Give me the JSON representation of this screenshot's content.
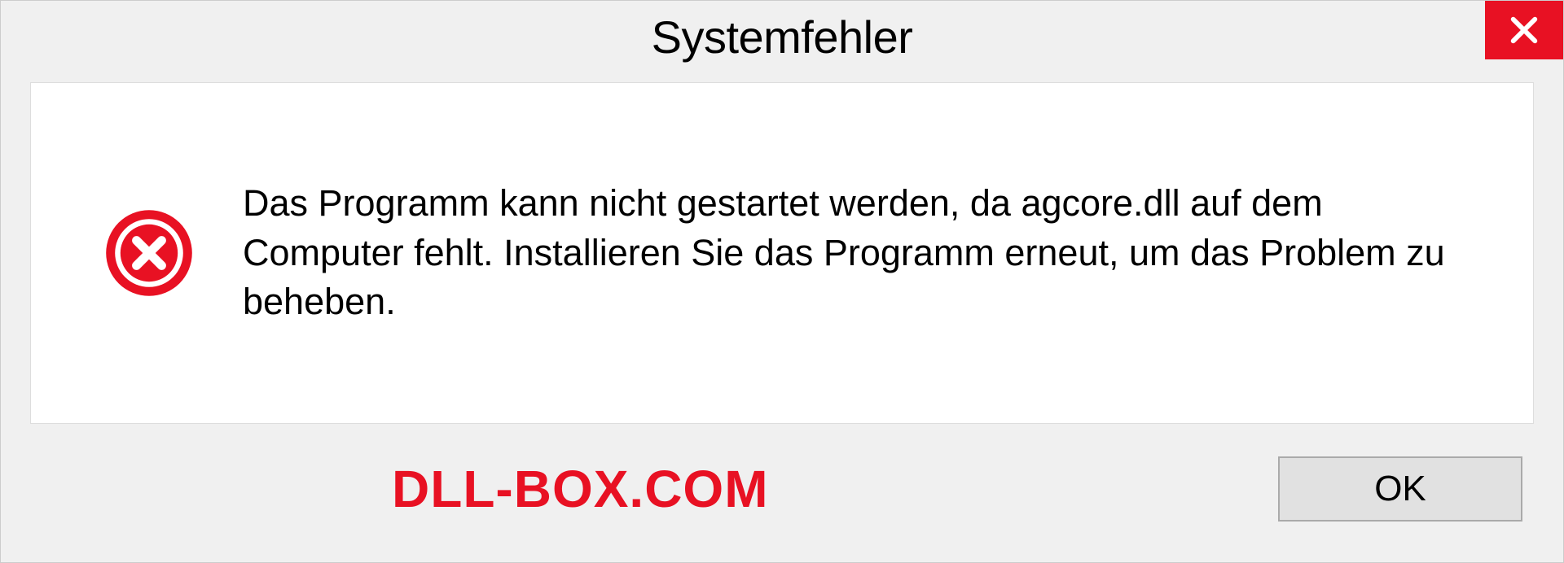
{
  "dialog": {
    "title": "Systemfehler",
    "message": "Das Programm kann nicht gestartet werden, da agcore.dll auf dem Computer fehlt. Installieren Sie das Programm erneut, um das Problem zu beheben.",
    "ok_label": "OK"
  },
  "watermark": "DLL-BOX.COM"
}
